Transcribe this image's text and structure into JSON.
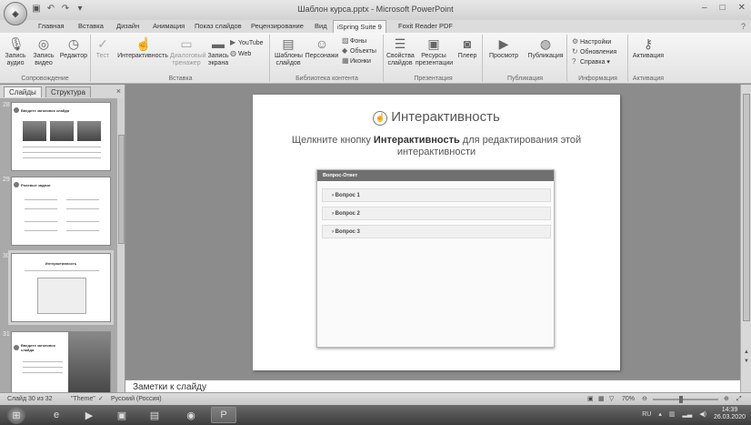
{
  "window": {
    "title": "Шаблон курса.pptx - Microsoft PowerPoint",
    "office_button": "Office",
    "min": "–",
    "max": "□",
    "close": "✕",
    "help": "?"
  },
  "tabs": [
    {
      "label": "Главная"
    },
    {
      "label": "Вставка"
    },
    {
      "label": "Дизайн"
    },
    {
      "label": "Анимация"
    },
    {
      "label": "Показ слайдов"
    },
    {
      "label": "Рецензирование"
    },
    {
      "label": "Вид"
    },
    {
      "label": "iSpring Suite 9",
      "active": true
    },
    {
      "label": "Foxit Reader PDF"
    }
  ],
  "ribbon": {
    "groups": {
      "narration": "Сопровождение",
      "insert": "Вставка",
      "content_library": "Библиотека контента",
      "presentation": "Презентация",
      "publish": "Публикация",
      "info": "Информация",
      "activation": "Активация"
    },
    "buttons": {
      "record_audio": [
        "Запись",
        "аудио"
      ],
      "record_video": [
        "Запись",
        "видео"
      ],
      "editor": [
        "Редактор",
        ""
      ],
      "test": [
        "Тест",
        ""
      ],
      "interactivity": [
        "Интерактивность",
        ""
      ],
      "dialog_trainer": [
        "Диалоговый",
        "тренажер"
      ],
      "screen_record": [
        "Запись",
        "экрана"
      ],
      "youtube": "YouTube",
      "web": "Web",
      "slide_templates": [
        "Шаблоны",
        "слайдов"
      ],
      "characters": [
        "Персонажи",
        ""
      ],
      "backgrounds": "Фоны",
      "objects": "Объекты",
      "icons": "Иконки",
      "slide_props": [
        "Свойства",
        "слайдов"
      ],
      "presentation_resources": [
        "Ресурсы",
        "презентации"
      ],
      "player": [
        "Плеер",
        ""
      ],
      "preview": [
        "Просмотр",
        ""
      ],
      "publish": [
        "Публикация",
        ""
      ],
      "settings": "Настройки",
      "updates": "Обновления",
      "help": "Справка ▾",
      "activation": [
        "Активация",
        ""
      ]
    }
  },
  "left_pane": {
    "tab_slides": "Слайды",
    "tab_outline": "Структура",
    "close": "×",
    "thumbs": [
      {
        "num": "28",
        "title": "Введите заголовок слайда"
      },
      {
        "num": "29",
        "title": "Ролевые задачи"
      },
      {
        "num": "30",
        "title": "Интерактивность",
        "selected": true
      },
      {
        "num": "31",
        "title": "Введите заголовок слайда"
      }
    ]
  },
  "slide": {
    "title": "Интерактивность",
    "subtitle_pre": "Щелкните кнопку ",
    "subtitle_bold": "Интерактивность",
    "subtitle_post": " для редактирования этой интерактивности",
    "widget_header": "Вопрос-Ответ",
    "questions": [
      "Вопрос 1",
      "Вопрос 2",
      "Вопрос 3"
    ]
  },
  "notes": "Заметки к слайду",
  "status": {
    "slide_counter": "Слайд 30 из 32",
    "theme": "\"Theme\"",
    "language": "Русский (Россия)",
    "zoom": "70%",
    "zoom_level": 0.42
  },
  "taskbar": {
    "lang": "RU",
    "time": "14:39",
    "date": "26.03.2020"
  },
  "colors": {
    "ribbon_bg": "#f0f0f0",
    "edit_bg": "#8c8c8c",
    "widget_header": "#707070",
    "taskbar": "#4a4a4a"
  }
}
